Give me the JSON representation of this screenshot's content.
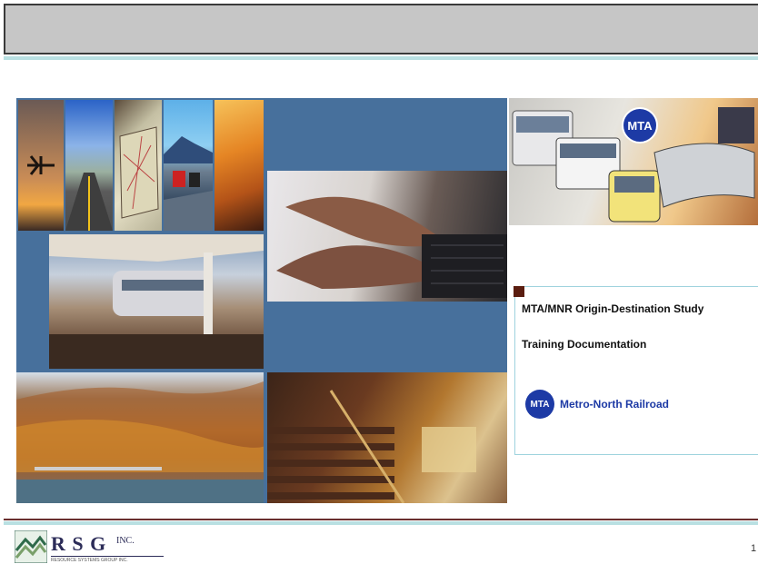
{
  "slide": {
    "title": "MTA/MNR Origin-Destination Study",
    "subtitle": "Training Documentation",
    "partner_logo_abbr": "MTA",
    "partner_name": "Metro-North Railroad",
    "collage_logo_abbr": "MTA"
  },
  "footer": {
    "company_letters": "R S G",
    "company_suffix": "INC.",
    "company_tagline": "RESOURCE SYSTEMS GROUP INC.",
    "page_number": "1"
  },
  "colors": {
    "header_band": "#c6c6c6",
    "accent_teal": "#b9e0e2",
    "collage_blue": "#47709c",
    "mta_blue": "#1d3aa5",
    "marker_brown": "#5a1d10"
  }
}
